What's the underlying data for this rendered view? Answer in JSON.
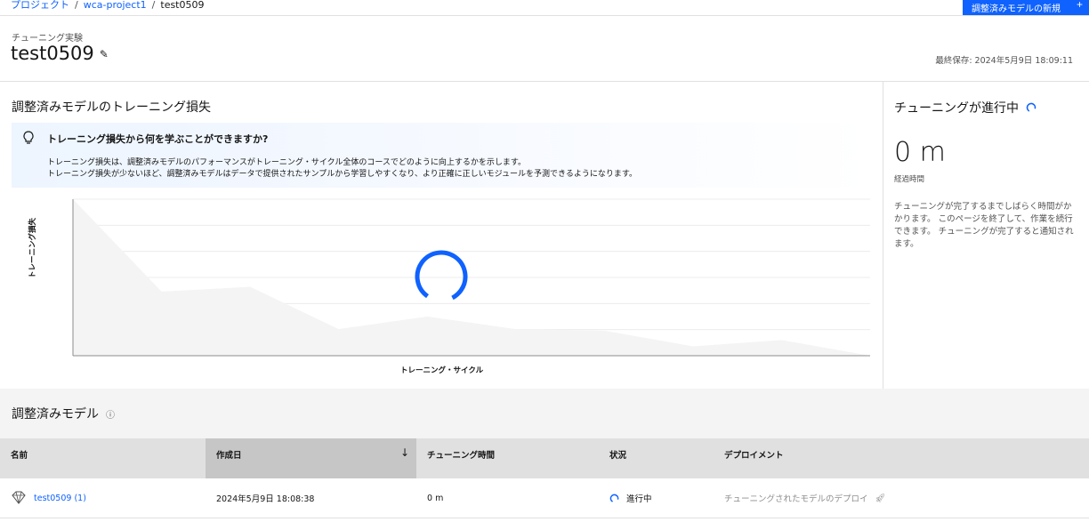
{
  "breadcrumb": {
    "items": [
      "プロジェクト",
      "wca-project1"
    ],
    "current": "test0509",
    "separator": "/"
  },
  "header": {
    "new_model_button": "調整済みモデルの新規",
    "subtitle": "チューニング実験",
    "title": "test0509",
    "last_saved": "最終保存: 2024年5月9日 18:09:11"
  },
  "loss_panel": {
    "title": "調整済みモデルのトレーニング損失",
    "tip": {
      "title": "トレーニング損失から何を学ぶことができますか?",
      "line1": "トレーニング損失は、調整済みモデルのパフォーマンスがトレーニング・サイクル全体のコースでどのように向上するかを示します。",
      "line2": "トレーニング損失が少ないほど、調整済みモデルはデータで提供されたサンプルから学習しやすくなり、より正確に正しいモジュールを予測できるようになります。"
    }
  },
  "chart_data": {
    "type": "area",
    "xlabel": "トレーニング・サイクル",
    "ylabel": "トレーニング損失",
    "values": [
      1.0,
      0.41,
      0.44,
      0.17,
      0.25,
      0.17,
      0.16,
      0.06,
      0.1,
      0.0
    ],
    "ylim": [
      0,
      1
    ],
    "grid": true,
    "loading": true
  },
  "status_panel": {
    "title": "チューニングが進行中",
    "elapsed_value": "0 m",
    "elapsed_label": "経過時間",
    "description": "チューニングが完了するまでしばらく時間がかかります。 このページを終了して、作業を続行できます。 チューニングが完了すると通知されます。"
  },
  "models": {
    "title": "調整済みモデル",
    "columns": [
      "名前",
      "作成日",
      "チューニング時間",
      "状況",
      "デプロイメント"
    ],
    "rows": [
      {
        "name": "test0509 (1)",
        "created": "2024年5月9日 18:08:38",
        "duration": "0 m",
        "status": "進行中",
        "deployment": "チューニングされたモデルのデプロイ"
      }
    ]
  },
  "colors": {
    "primary": "#0f62fe",
    "chart_fill": "#f4f4f4",
    "table_header": "#e0e0e0",
    "sorted_header": "#c6c6c6"
  }
}
